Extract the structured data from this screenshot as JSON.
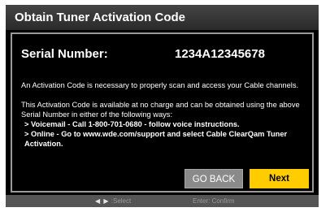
{
  "dialog": {
    "title": "Obtain Tuner Activation Code",
    "serial_label": "Serial Number:",
    "serial_value": "1234A12345678",
    "paragraph1": "An Activation Code is necessary to properly scan and access your Cable channels.",
    "paragraph2": "This Activation Code is available at no charge and can be obtained using the above Serial Number in either of the following ways:",
    "bullets": [
      "> Voicemail - Call 1-800-701-0680 - follow voice instructions.",
      "> Online - Go to www.wde.com/support and select Cable ClearQam Tuner Activation."
    ],
    "buttons": {
      "back_label": "GO BACK",
      "next_label": "Next"
    }
  },
  "footer": {
    "arrows": "◀ ▶",
    "select_hint": ":Select",
    "confirm_hint": "Enter: Confirm"
  },
  "colors": {
    "background": "#000000",
    "title_bar": "#3a3a3a",
    "accent_next": "#ffcc00",
    "back_button": "#8a8a8a",
    "footer": "#555555"
  },
  "icons": {
    "left_arrow": "left-arrow-icon",
    "right_arrow": "right-arrow-icon"
  }
}
